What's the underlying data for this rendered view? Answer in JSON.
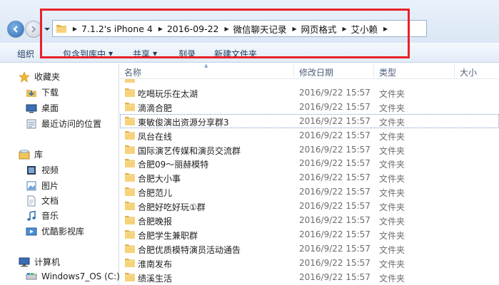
{
  "address": {
    "crumbs": [
      "7.1.2's iPhone 4",
      "2016-09-22",
      "微信聊天记录",
      "网页格式",
      "艾小赖"
    ]
  },
  "toolbar": {
    "organize": "组织",
    "include_in_library": "包含到库中",
    "share": "共享",
    "burn": "刻录",
    "new_folder": "新建文件夹"
  },
  "sidebar": {
    "favorites": {
      "label": "收藏夹",
      "items": [
        {
          "label": "下载",
          "icon": "download-folder-icon"
        },
        {
          "label": "桌面",
          "icon": "desktop-icon"
        },
        {
          "label": "最近访问的位置",
          "icon": "recent-places-icon"
        }
      ]
    },
    "libraries": {
      "label": "库",
      "items": [
        {
          "label": "视频",
          "icon": "video-library-icon"
        },
        {
          "label": "图片",
          "icon": "pictures-library-icon"
        },
        {
          "label": "文档",
          "icon": "documents-library-icon"
        },
        {
          "label": "音乐",
          "icon": "music-library-icon"
        },
        {
          "label": "优酷影视库",
          "icon": "youku-library-icon"
        }
      ]
    },
    "computer": {
      "label": "计算机",
      "items": [
        {
          "label": "Windows7_OS (C:)",
          "icon": "drive-icon"
        }
      ]
    }
  },
  "columns": {
    "name": "名称",
    "date": "修改日期",
    "type": "类型",
    "size": "大小"
  },
  "files": [
    {
      "name": "",
      "date": "",
      "type": ""
    },
    {
      "name": "吃喝玩乐在太湖",
      "date": "2016/9/22 15:57",
      "type": "文件夹"
    },
    {
      "name": "滴滴合肥",
      "date": "2016/9/22 15:57",
      "type": "文件夹"
    },
    {
      "name": "東敏俊演出资源分享群3",
      "date": "2016/9/22 15:57",
      "type": "文件夹"
    },
    {
      "name": "凤台在线",
      "date": "2016/9/22 15:57",
      "type": "文件夹"
    },
    {
      "name": "国际演艺传媒和演员交流群",
      "date": "2016/9/22 15:57",
      "type": "文件夹"
    },
    {
      "name": "合肥09～丽赫模特",
      "date": "2016/9/22 15:57",
      "type": "文件夹"
    },
    {
      "name": "合肥大小事",
      "date": "2016/9/22 15:57",
      "type": "文件夹"
    },
    {
      "name": "合肥范儿",
      "date": "2016/9/22 15:57",
      "type": "文件夹"
    },
    {
      "name": "合肥好吃好玩①群",
      "date": "2016/9/22 15:57",
      "type": "文件夹"
    },
    {
      "name": "合肥晚报",
      "date": "2016/9/22 15:57",
      "type": "文件夹"
    },
    {
      "name": "合肥学生兼职群",
      "date": "2016/9/22 15:57",
      "type": "文件夹"
    },
    {
      "name": "合肥优质模特演员活动通告",
      "date": "2016/9/22 15:57",
      "type": "文件夹"
    },
    {
      "name": "淮南发布",
      "date": "2016/9/22 15:57",
      "type": "文件夹"
    },
    {
      "name": "绩溪生活",
      "date": "2016/9/22 15:57",
      "type": "文件夹"
    }
  ],
  "colors": {
    "highlight_box": "#e8212a",
    "folder": "#f3c95a",
    "header_text": "#4c607a"
  }
}
